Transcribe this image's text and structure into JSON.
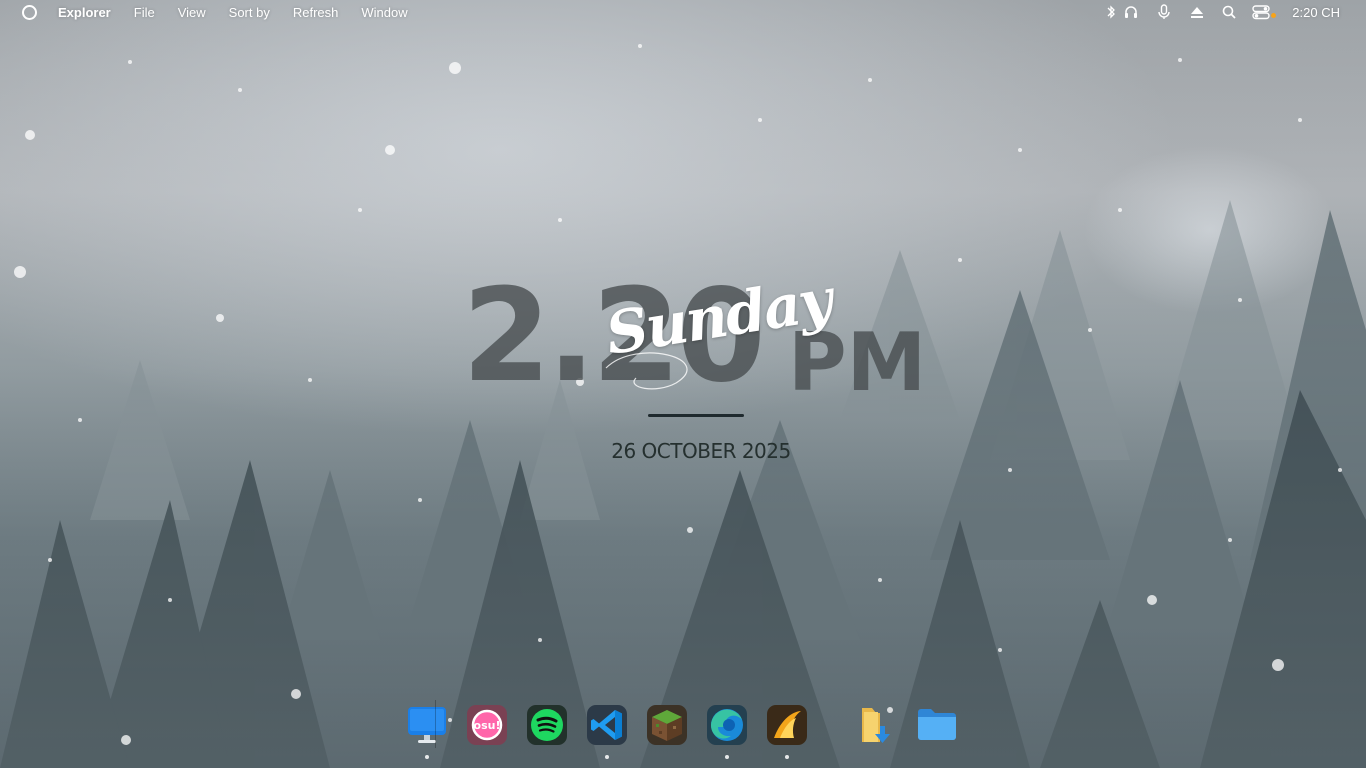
{
  "menubar": {
    "logo_icon": "circle-logo-icon",
    "app_name": "Explorer",
    "menus": [
      "File",
      "View",
      "Sort by",
      "Refresh",
      "Window"
    ],
    "tray_icons": [
      "bluetooth-icon",
      "headphones-icon",
      "microphone-icon",
      "eject-icon",
      "search-icon",
      "control-center-icon"
    ],
    "clock": "2:20 CH"
  },
  "widget": {
    "time": "2.20",
    "ampm": "PM",
    "day": "Sunday",
    "date": "26 OCTOBER 2025"
  },
  "dock": {
    "apps": [
      {
        "name": "monitor",
        "icon": "monitor-icon",
        "running": true
      },
      {
        "name": "osu!",
        "icon": "osu-icon",
        "label": "osu!",
        "running": false
      },
      {
        "name": "spotify",
        "icon": "spotify-icon",
        "running": false
      },
      {
        "name": "vscode",
        "icon": "vscode-icon",
        "running": true
      },
      {
        "name": "minecraft",
        "icon": "minecraft-icon",
        "running": false
      },
      {
        "name": "edge",
        "icon": "edge-icon",
        "running": true
      },
      {
        "name": "lol",
        "icon": "lol-icon",
        "running": true
      }
    ],
    "folders": [
      {
        "name": "downloads",
        "icon": "downloads-folder-icon"
      },
      {
        "name": "files",
        "icon": "folder-icon"
      }
    ]
  },
  "colors": {
    "accent_dot": "#f7a319",
    "ampm_text": "#464c4e",
    "date_text": "#25302f",
    "folder_blue": "#3c9be6",
    "spotify_green": "#1ed760",
    "osu_pink": "#ff66aa",
    "vscode_blue": "#1f9cf0"
  }
}
